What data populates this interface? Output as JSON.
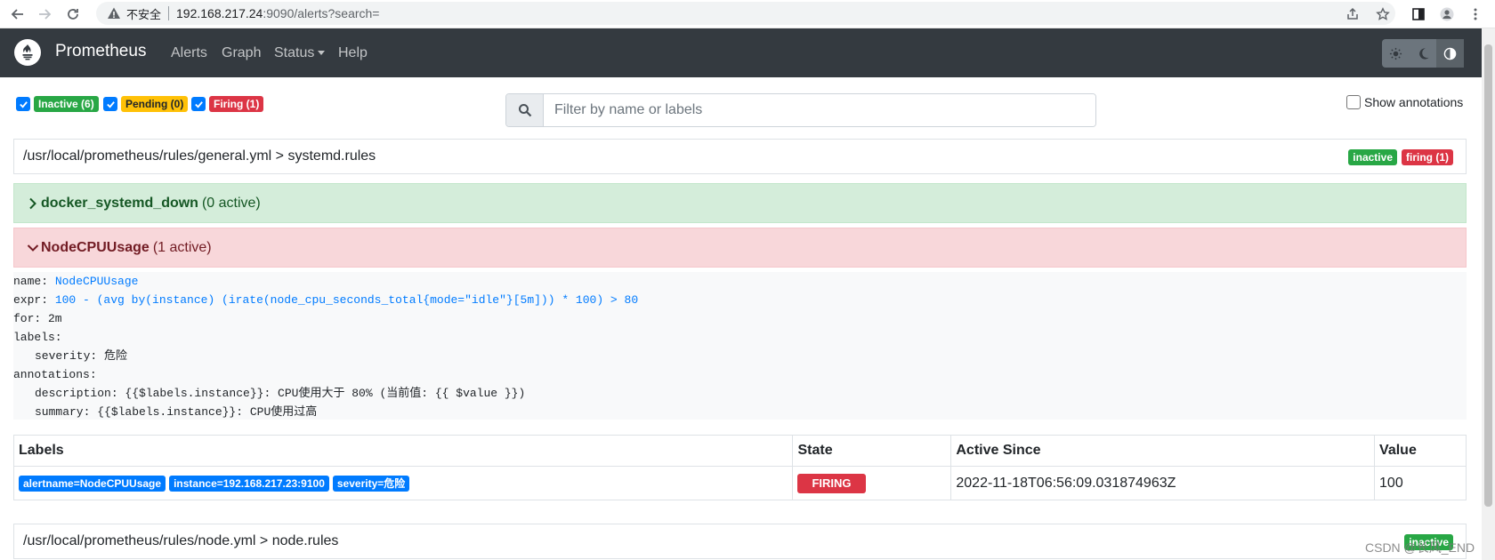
{
  "browser": {
    "insecure_label": "不安全",
    "url_host": "192.168.217.24",
    "url_rest": ":9090/alerts?search="
  },
  "navbar": {
    "brand": "Prometheus",
    "links": [
      "Alerts",
      "Graph",
      "Status",
      "Help"
    ]
  },
  "filters": {
    "inactive": "Inactive (6)",
    "pending": "Pending (0)",
    "firing": "Firing (1)",
    "search_placeholder": "Filter by name or labels",
    "show_annotations": "Show annotations"
  },
  "groups": [
    {
      "path": "/usr/local/prometheus/rules/general.yml > systemd.rules",
      "badges": [
        "inactive",
        "firing (1)"
      ],
      "rules": [
        {
          "name": "docker_systemd_down",
          "count": "(0 active)",
          "state": "inactive"
        },
        {
          "name": "NodeCPUUsage",
          "count": "(1 active)",
          "state": "firing"
        }
      ],
      "definition": {
        "name_key": "name:",
        "name_val": "NodeCPUUsage",
        "expr_key": "expr:",
        "expr_val": "100 - (avg by(instance) (irate(node_cpu_seconds_total{mode=\"idle\"}[5m])) * 100) > 80",
        "for": "for: 2m",
        "labels_key": "labels:",
        "severity": "severity: 危险",
        "annotations_key": "annotations:",
        "description": "description: {{$labels.instance}}: CPU使用大于 80% (当前值: {{ $value }})",
        "summary": "summary: {{$labels.instance}}: CPU使用过高"
      },
      "table": {
        "headers": [
          "Labels",
          "State",
          "Active Since",
          "Value"
        ],
        "rows": [
          {
            "labels": [
              "alertname=NodeCPUUsage",
              "instance=192.168.217.23:9100",
              "severity=危险"
            ],
            "state": "FIRING",
            "active_since": "2022-11-18T06:56:09.031874963Z",
            "value": "100"
          }
        ]
      }
    },
    {
      "path": "/usr/local/prometheus/rules/node.yml > node.rules",
      "badges": [
        "inactive"
      ]
    }
  ],
  "watermark": "CSDN @长风_END",
  "colors": {
    "navbar": "#343a40",
    "success": "#28a745",
    "danger": "#dc3545",
    "warning": "#ffc107",
    "primary": "#007bff"
  }
}
